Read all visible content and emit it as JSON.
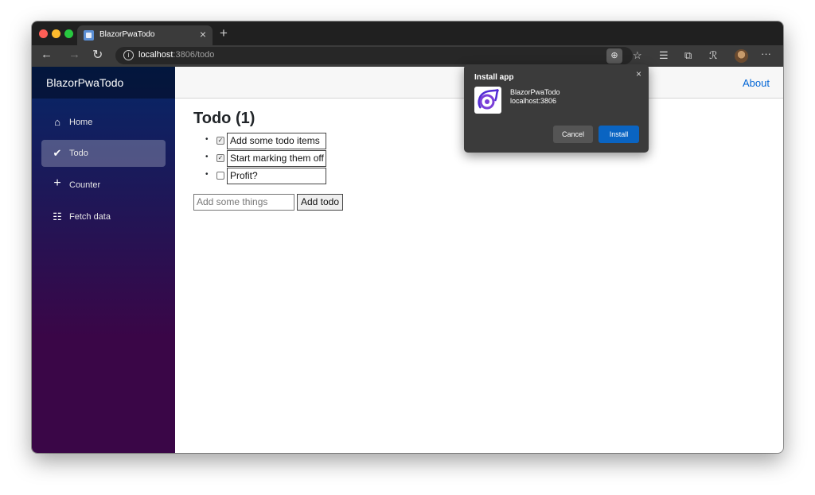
{
  "browser": {
    "tab_title": "BlazorPwaTodo",
    "tab_close_glyph": "×",
    "new_tab_glyph": "+",
    "url_host": "localhost",
    "url_rest": ":3806/todo",
    "icons": [
      "back-arrow-icon",
      "forward-arrow-icon",
      "refresh-icon",
      "info-icon",
      "install-app-icon",
      "favorite-star-icon",
      "favorites-list-icon",
      "collections-icon",
      "read-aloud-icon",
      "profile-avatar-icon",
      "more-menu-icon"
    ]
  },
  "sidebar": {
    "brand": "BlazorPwaTodo",
    "items": [
      {
        "label": "Home",
        "icon": "home-icon"
      },
      {
        "label": "Todo",
        "icon": "check-circle-icon"
      },
      {
        "label": "Counter",
        "icon": "plus-icon"
      },
      {
        "label": "Fetch data",
        "icon": "list-icon"
      }
    ],
    "active_index": 1
  },
  "topbar": {
    "about": "About"
  },
  "main": {
    "title": "Todo (1)",
    "todos": [
      {
        "text": "Add some todo items",
        "done": true
      },
      {
        "text": "Start marking them off t",
        "done": true
      },
      {
        "text": "Profit?",
        "done": false
      }
    ],
    "new_todo_placeholder": "Add some things",
    "add_button": "Add todo"
  },
  "install_popup": {
    "title": "Install app",
    "close_glyph": "×",
    "app_name": "BlazorPwaTodo",
    "app_host": "localhost:3806",
    "cancel": "Cancel",
    "install": "Install"
  },
  "colors": {
    "accent_link": "#0366d6",
    "install_button": "#0a64c2",
    "sidebar_top": "#052767",
    "sidebar_bottom": "#3a0647"
  }
}
